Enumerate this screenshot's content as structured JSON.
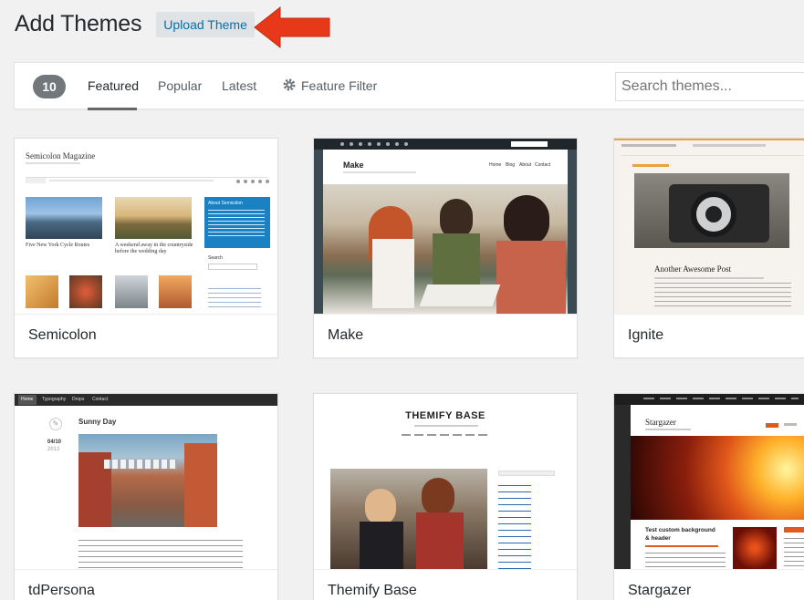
{
  "header": {
    "title": "Add Themes",
    "upload_label": "Upload Theme"
  },
  "filter_bar": {
    "count": "10",
    "tabs": [
      {
        "label": "Featured",
        "active": true
      },
      {
        "label": "Popular",
        "active": false
      },
      {
        "label": "Latest",
        "active": false
      }
    ],
    "feature_filter_label": "Feature Filter",
    "search_placeholder": "Search themes..."
  },
  "themes": [
    {
      "name": "Semicolon",
      "preview": {
        "site_title": "Semicolon Magazine",
        "post1": "Five New York Cycle Routes",
        "post2_line1": "A weekend away in the countryside",
        "post2_line2": "before the wedding day",
        "widget_title": "About Semicolon",
        "search_label": "Search"
      }
    },
    {
      "name": "Make",
      "preview": {
        "site_title": "Make",
        "nav": [
          "Home",
          "Blog",
          "About",
          "Contact"
        ]
      }
    },
    {
      "name": "Ignite",
      "preview": {
        "post_title": "Another Awesome Post"
      }
    },
    {
      "name": "tdPersona",
      "preview": {
        "nav": [
          "Home",
          "Typography",
          "Drops",
          "Contact"
        ],
        "post_title": "Sunny Day",
        "date": "04/10",
        "year": "2013"
      }
    },
    {
      "name": "Themify Base",
      "preview": {
        "site_title": "THEMIFY BASE"
      }
    },
    {
      "name": "Stargazer",
      "preview": {
        "site_title": "Stargazer",
        "post_title_line1": "Test custom background",
        "post_title_line2": "& header"
      }
    }
  ],
  "colors": {
    "accent": "#0073aa",
    "arrow": "#e8381a",
    "background": "#f1f1f1"
  }
}
